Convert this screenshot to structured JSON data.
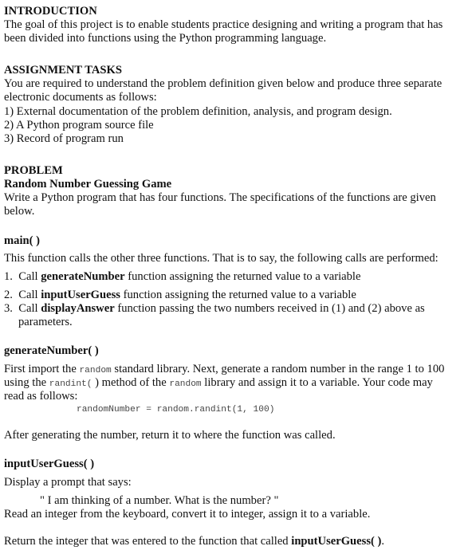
{
  "introduction": {
    "heading": "INTRODUCTION",
    "line1": "The goal of this project is to enable students practice designing and writing a program that has",
    "line2": "been divided into functions using the Python programming language."
  },
  "assignment": {
    "heading": "ASSIGNMENT TASKS",
    "line1": "You are required to understand the problem definition given below and produce three separate",
    "line2": "electronic documents as follows:",
    "items": [
      "1) External documentation of the problem definition, analysis, and program design.",
      "2) A Python program source file",
      "3) Record of program run"
    ]
  },
  "problem": {
    "heading": "PROBLEM",
    "subheading": "Random Number Guessing Game",
    "line1": "Write a Python program that has four functions. The specifications of the functions are given",
    "line2": "below."
  },
  "main_fn": {
    "heading": "main( )",
    "intro": "This function calls the other three functions. That is to say, the following calls are performed:",
    "steps": [
      {
        "num": "1.",
        "pre": "Call ",
        "bold": "generateNumber",
        "post": " function assigning the returned value to a variable"
      },
      {
        "num": "2.",
        "pre": "Call ",
        "bold": "inputUserGuess",
        "post": " function assigning the returned value to a variable"
      },
      {
        "num": "3.",
        "pre": "Call ",
        "bold": "displayAnswer",
        "post": " function passing the two numbers received in (1) and (2) above as"
      }
    ],
    "step3_cont": "parameters."
  },
  "generate_fn": {
    "heading": "generateNumber( )",
    "l1_a": "First import the ",
    "l1_code": "random",
    "l1_b": " standard library. Next, generate a random number in the range 1 to 100",
    "l2_a": "using the ",
    "l2_code": "randint(",
    "l2_b": " ) method of the ",
    "l2_code2": "random",
    "l2_c": " library and assign it to a variable. Your code may",
    "l3": "read as follows:",
    "code": "randomNumber = random.randint(1, 100)",
    "after": "After generating the number, return it to where the function was called."
  },
  "input_fn": {
    "heading": "inputUserGuess( )",
    "l1": "Display a prompt that says:",
    "prompt": "\" I am thinking of a number. What is the number?  \"",
    "l2": "Read an integer from the keyboard, convert it to integer, assign it to a variable.",
    "ret_a": "Return the integer that was entered to the function that called ",
    "ret_bold": "inputUserGuess( )",
    "ret_b": "."
  }
}
